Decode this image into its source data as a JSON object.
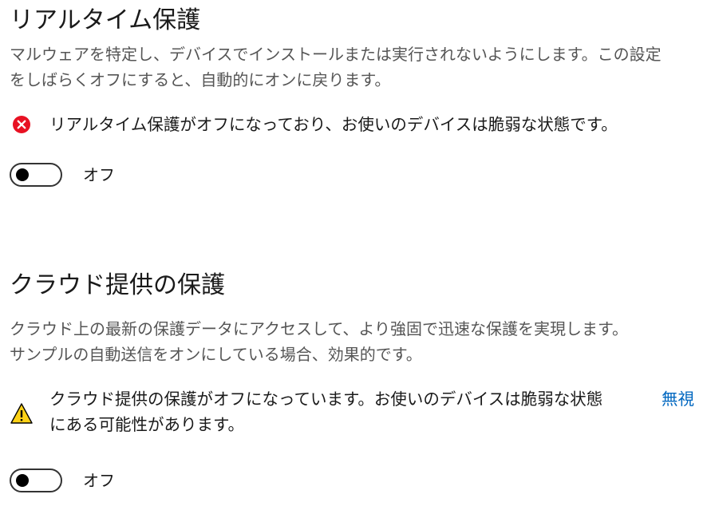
{
  "realtime": {
    "title": "リアルタイム保護",
    "description_lines": [
      "マルウェアを特定し、デバイスでインストールまたは実行されないようにします。この設定",
      "をしばらくオフにすると、自動的にオンに戻ります。"
    ],
    "status": {
      "icon": "error-circle-icon",
      "color": "#e81123",
      "text": "リアルタイム保護がオフになっており、お使いのデバイスは脆弱な状態です。"
    },
    "toggle": {
      "state": "off",
      "label": "オフ"
    }
  },
  "cloud": {
    "title": "クラウド提供の保護",
    "description_lines": [
      "クラウド上の最新の保護データにアクセスして、より強固で迅速な保護を実現します。",
      "サンプルの自動送信をオンにしている場合、効果的です。"
    ],
    "status": {
      "icon": "warning-triangle-icon",
      "color": "#fcd116",
      "text_lines": [
        "クラウド提供の保護がオフになっています。お使いのデバイスは脆弱な状態",
        "にある可能性があります。"
      ],
      "dismiss_label": "無視"
    },
    "toggle": {
      "state": "off",
      "label": "オフ"
    }
  },
  "colors": {
    "link": "#0067c0",
    "error": "#e81123",
    "warning": "#fcd116"
  }
}
